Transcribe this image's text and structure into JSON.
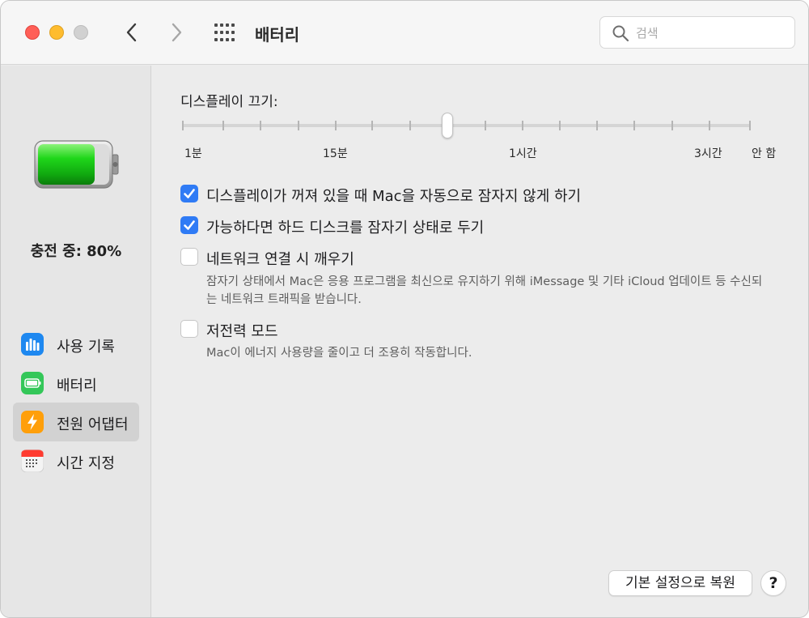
{
  "window": {
    "title": "배터리",
    "search_placeholder": "검색"
  },
  "sidebar": {
    "charge_status": "충전 중: 80%",
    "charge_level": 0.8,
    "items": [
      {
        "label": "사용 기록",
        "icon": "usage-history-icon",
        "color": "#1e88f0"
      },
      {
        "label": "배터리",
        "icon": "battery-icon",
        "color": "#34c759"
      },
      {
        "label": "전원 어댑터",
        "icon": "lightning-icon",
        "color": "#ff9f0a",
        "selected": true
      },
      {
        "label": "시간 지정",
        "icon": "calendar-icon",
        "color": "#ff3b30"
      }
    ]
  },
  "display_sleep": {
    "title": "디스플레이 끄기:",
    "labels": [
      "1분",
      "15분",
      "1시간",
      "3시간",
      "안 함"
    ]
  },
  "options": [
    {
      "label": "디스플레이가 꺼져 있을 때 Mac을 자동으로 잠자지 않게 하기",
      "checked": true,
      "description": ""
    },
    {
      "label": "가능하다면 하드 디스크를 잠자기 상태로 두기",
      "checked": true,
      "description": ""
    },
    {
      "label": "네트워크 연결 시 깨우기",
      "checked": false,
      "description": "잠자기 상태에서 Mac은 응용 프로그램을 최신으로 유지하기 위해 iMessage 및 기타 iCloud 업데이트 등 수신되는 네트워크 트래픽을 받습니다."
    },
    {
      "label": "저전력 모드",
      "checked": false,
      "description": "Mac이 에너지 사용량을 줄이고 더 조용히 작동합니다."
    }
  ],
  "buttons": {
    "restore_defaults": "기본 설정으로 복원",
    "help": "?"
  },
  "colors": {
    "accent": "#2f7bf5",
    "battery_green": "#2ecc1f",
    "close": "#ff5f57",
    "minimize": "#febc2e"
  }
}
